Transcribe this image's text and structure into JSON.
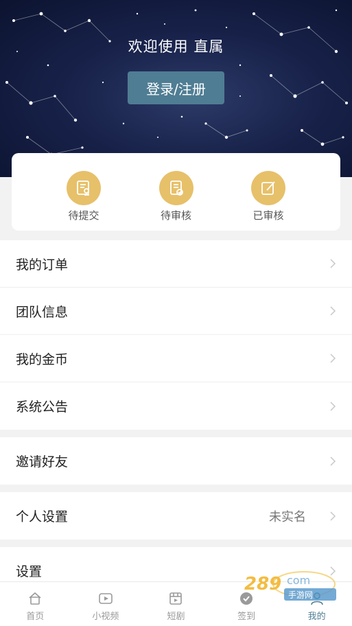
{
  "header": {
    "welcome_text": "欢迎使用 直属",
    "login_button": "登录/注册"
  },
  "status_tabs": [
    {
      "label": "待提交",
      "icon": "form-stamp-icon"
    },
    {
      "label": "待审核",
      "icon": "document-check-icon"
    },
    {
      "label": "已审核",
      "icon": "edit-pencil-icon"
    }
  ],
  "menu_group_1": [
    {
      "label": "我的订单"
    },
    {
      "label": "团队信息"
    },
    {
      "label": "我的金币"
    },
    {
      "label": "系统公告"
    }
  ],
  "menu_group_2": [
    {
      "label": "邀请好友"
    }
  ],
  "menu_group_3": [
    {
      "label": "个人设置",
      "value": "未实名"
    }
  ],
  "menu_group_4": [
    {
      "label": "设置"
    }
  ],
  "tabbar": [
    {
      "label": "首页",
      "icon": "home-icon"
    },
    {
      "label": "小视频",
      "icon": "video-icon"
    },
    {
      "label": "短剧",
      "icon": "film-icon"
    },
    {
      "label": "签到",
      "icon": "checkin-icon"
    },
    {
      "label": "我的",
      "icon": "user-icon",
      "active": true
    }
  ],
  "colors": {
    "accent": "#4f7d93",
    "status_icon_bg": "#e7c06a"
  }
}
